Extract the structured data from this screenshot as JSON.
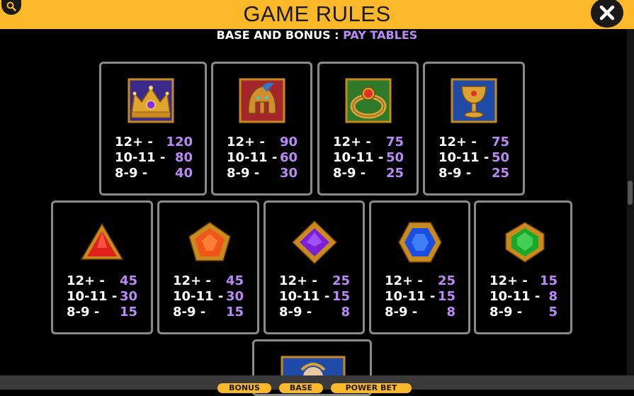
{
  "header": {
    "title": "GAME RULES"
  },
  "subtitle": {
    "prefix": "BASE AND BONUS : ",
    "accent": "PAY TABLES"
  },
  "rows_labels": {
    "r1": "12+ -",
    "r2": "10-11 -",
    "r3": "8-9 -"
  },
  "paytable": [
    {
      "symbol": "crown",
      "v12": "120",
      "v10": "80",
      "v8": "40"
    },
    {
      "symbol": "helmet",
      "v12": "90",
      "v10": "60",
      "v8": "30"
    },
    {
      "symbol": "ring",
      "v12": "75",
      "v10": "50",
      "v8": "25"
    },
    {
      "symbol": "chalice",
      "v12": "75",
      "v10": "50",
      "v8": "25"
    },
    {
      "symbol": "red-triangle-gem",
      "v12": "45",
      "v10": "30",
      "v8": "15"
    },
    {
      "symbol": "orange-pentagon-gem",
      "v12": "45",
      "v10": "30",
      "v8": "15"
    },
    {
      "symbol": "purple-diamond-gem",
      "v12": "25",
      "v10": "15",
      "v8": "8"
    },
    {
      "symbol": "blue-hexagon-gem",
      "v12": "25",
      "v10": "15",
      "v8": "8"
    },
    {
      "symbol": "green-shield-gem",
      "v12": "15",
      "v10": "8",
      "v8": "5"
    }
  ],
  "bottom_tabs": {
    "bonus": "BONUS",
    "base": "BASE",
    "power_bet": "POWER BET"
  },
  "colors": {
    "accent": "#b98af5",
    "header": "#fbb829",
    "border": "#8a8a8a"
  }
}
